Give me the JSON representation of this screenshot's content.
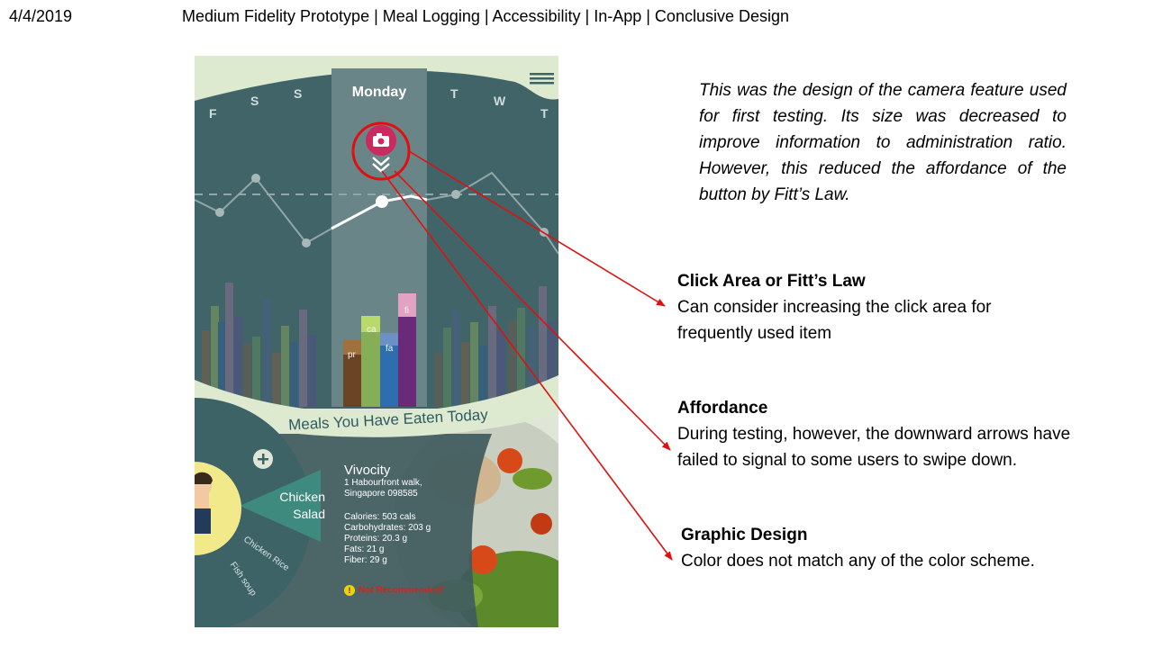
{
  "header": {
    "date": "4/4/2019",
    "breadcrumb": "Medium Fidelity Prototype | Meal Logging | Accessibility | In-App | Conclusive Design"
  },
  "app": {
    "days": {
      "f": "F",
      "s1": "S",
      "s2": "S",
      "active": "Monday",
      "t1": "T",
      "w": "W",
      "t2": "T"
    },
    "nutrients": {
      "protein": "pr",
      "carbs": "ca",
      "fat": "fa",
      "fiber": "fi"
    },
    "meals_title": "Meals You Have Eaten Today",
    "dish": {
      "line1": "Chicken",
      "line2": "Salad"
    },
    "other_meals": [
      "Chicken Rice",
      "Fish soup"
    ],
    "restaurant": {
      "name": "Vivocity",
      "address1": "1 Habourfront walk,",
      "address2": "Singapore 098585"
    },
    "nutrition": {
      "calories": "Calories: 503 cals",
      "carbohydrates": "Carbohydrates: 203 g",
      "proteins": "Proteins: 20.3 g",
      "fats": "Fats: 21 g",
      "fiber": "Fiber: 29 g"
    },
    "warning": "Not Recommended!",
    "warning_icon": "!",
    "add_icon": "+"
  },
  "note": "This was the design of the camera feature used for first testing. Its size was decreased to improve information to administration ratio. However, this reduced the affordance of the button by Fitt’s Law.",
  "annotations": [
    {
      "title": "Click Area or Fitt’s Law",
      "body": "Can consider increasing the click area for frequently used item"
    },
    {
      "title": "Affordance",
      "body": "During testing, however, the downward arrows have failed to signal to some users to swipe down."
    },
    {
      "title": "Graphic Design",
      "body": "Color does not match any of the color scheme."
    }
  ],
  "colors": {
    "panel": "#416468",
    "cream": "#deead0",
    "highlight_ring": "#e01010",
    "camera_button": "#cc2a5e"
  }
}
